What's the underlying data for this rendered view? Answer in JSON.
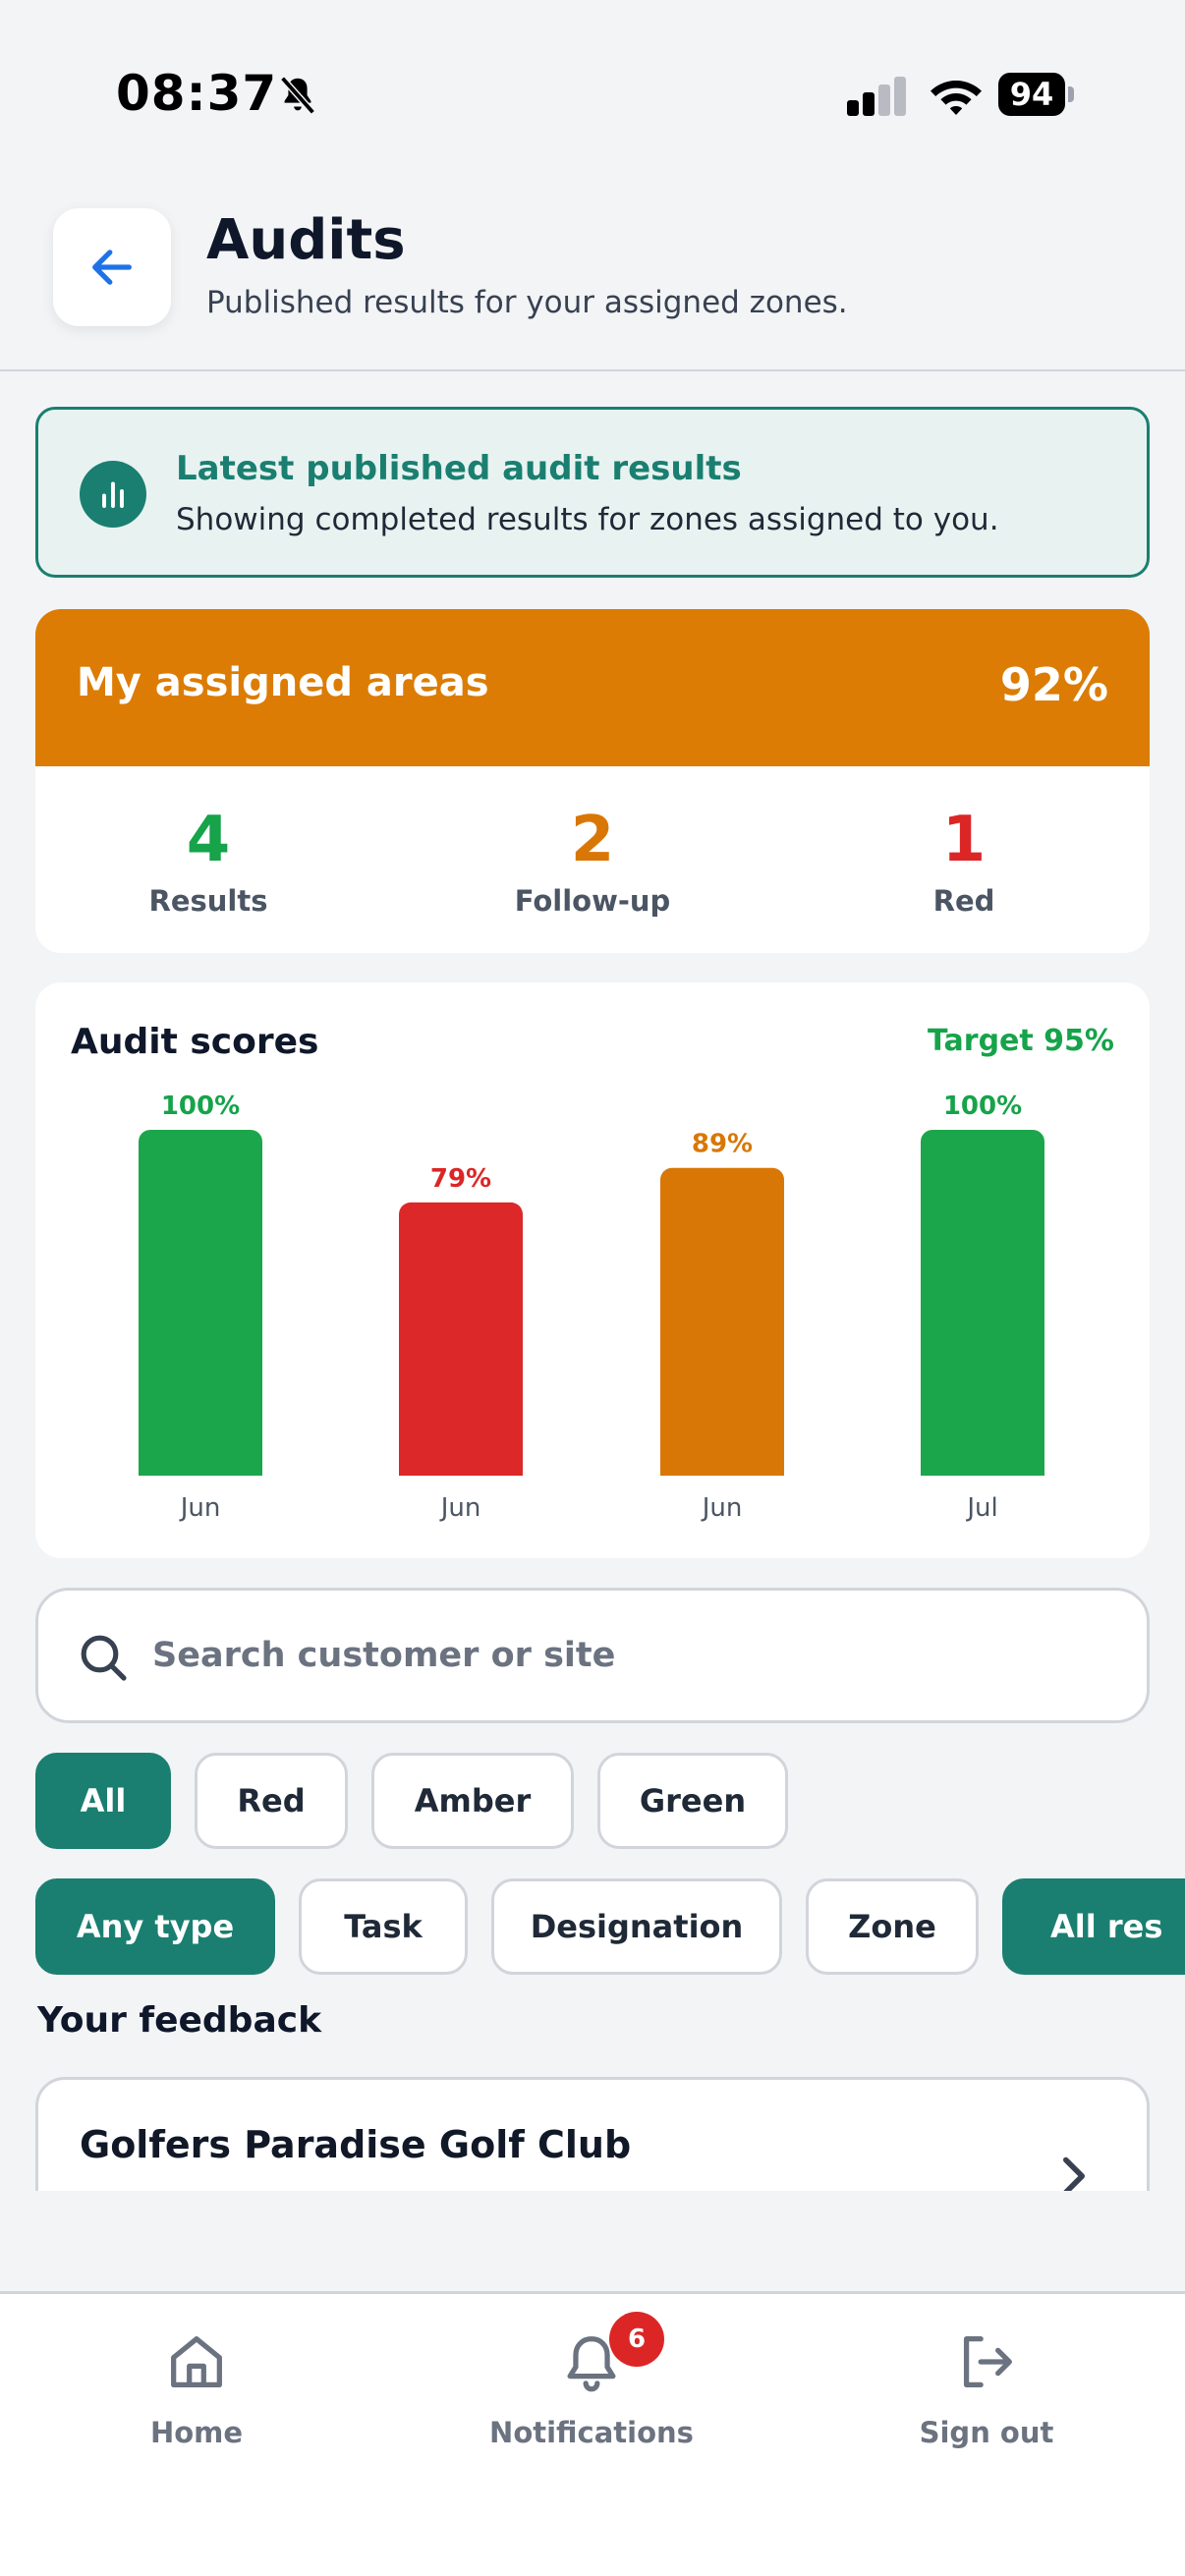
{
  "status_bar": {
    "time": "08:37",
    "battery": "94"
  },
  "header": {
    "title": "Audits",
    "subtitle": "Published results for your assigned zones."
  },
  "info_banner": {
    "title": "Latest published audit results",
    "text": "Showing completed results for zones assigned to you."
  },
  "summary": {
    "title": "My assigned areas",
    "percent": "92%",
    "header_color": "#dc7c04",
    "stats": [
      {
        "value": "4",
        "label": "Results",
        "color": "#16a34a"
      },
      {
        "value": "2",
        "label": "Follow-up",
        "color": "#d97706"
      },
      {
        "value": "1",
        "label": "Red",
        "color": "#dc2626"
      }
    ]
  },
  "chart": {
    "title": "Audit scores",
    "target_label": "Target 95%"
  },
  "chart_data": {
    "type": "bar",
    "title": "Audit scores",
    "categories": [
      "Jun",
      "Jun",
      "Jun",
      "Jul"
    ],
    "values": [
      100,
      79,
      89,
      100
    ],
    "value_labels": [
      "100%",
      "79%",
      "89%",
      "100%"
    ],
    "bar_colors": [
      "#1ca64c",
      "#dc2828",
      "#d97706",
      "#1ca64c"
    ],
    "label_colors": [
      "#16a34a",
      "#dc2626",
      "#d97706",
      "#16a34a"
    ],
    "ylim": [
      0,
      100
    ],
    "target": 95,
    "grid": false
  },
  "search": {
    "placeholder": "Search customer or site",
    "value": ""
  },
  "status_filters": [
    "All",
    "Red",
    "Amber",
    "Green"
  ],
  "status_filter_active": 0,
  "type_filters": [
    "Any type",
    "Task",
    "Designation",
    "Zone",
    "All res"
  ],
  "type_filter_active": [
    0,
    4
  ],
  "feedback": {
    "section_title": "Your feedback",
    "items": [
      {
        "name": "Golfers Paradise Golf Club"
      }
    ]
  },
  "nav": {
    "items": [
      {
        "label": "Home",
        "icon": "home-icon"
      },
      {
        "label": "Notifications",
        "icon": "bell-icon",
        "badge": "6"
      },
      {
        "label": "Sign out",
        "icon": "sign-out-icon"
      }
    ]
  }
}
